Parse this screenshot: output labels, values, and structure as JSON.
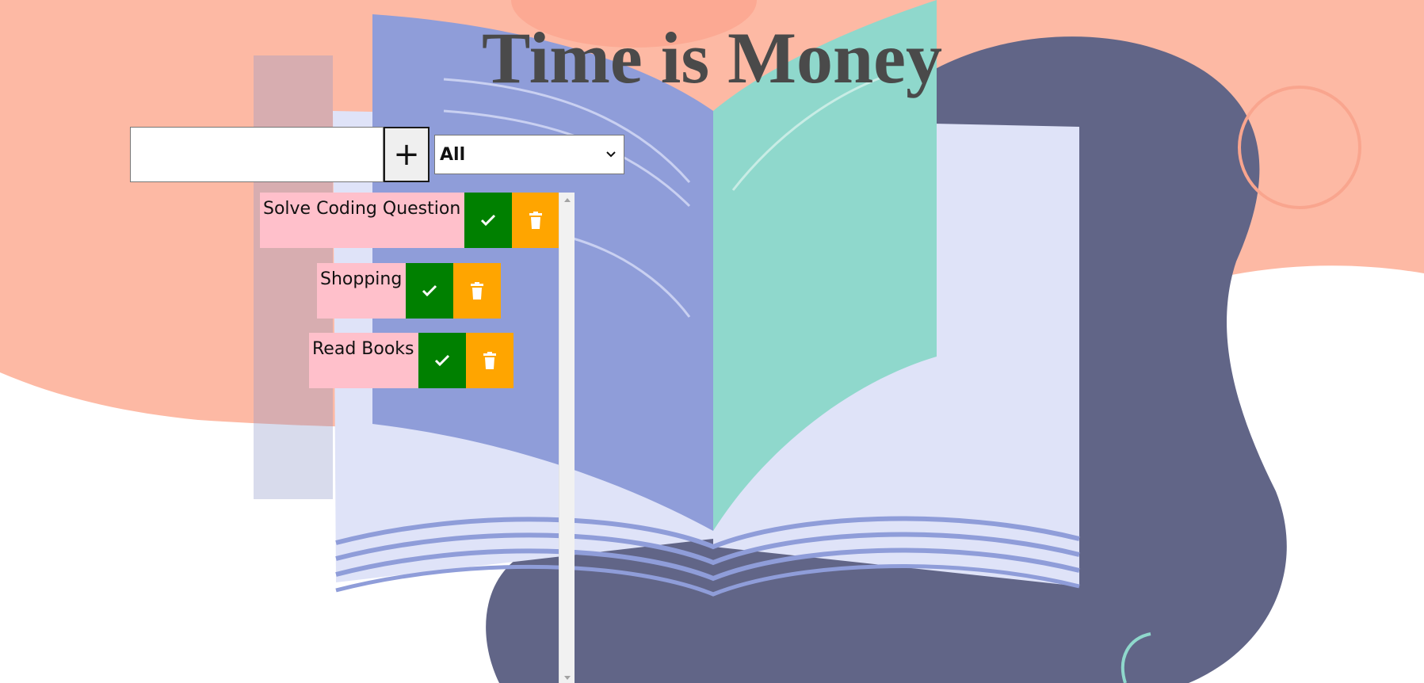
{
  "page": {
    "title": "Time is Money"
  },
  "form": {
    "input_value": "",
    "add_button_label": "+",
    "filter_selected": "All"
  },
  "todos": [
    {
      "text": "Solve Coding Question"
    },
    {
      "text": "Shopping"
    },
    {
      "text": "Read Books"
    }
  ],
  "icons": {
    "complete": "check-icon",
    "delete": "trash-icon",
    "filter_arrow": "chevron-down-icon"
  },
  "colors": {
    "title": "#4a4a4a",
    "todo_background": "#ffc0cb",
    "complete_button": "#008000",
    "delete_button": "#ffa500",
    "background_peach": "#fdb9a4",
    "background_navy": "#616587",
    "book_blue": "#8f9dd9",
    "book_teal": "#8fd8cc"
  }
}
